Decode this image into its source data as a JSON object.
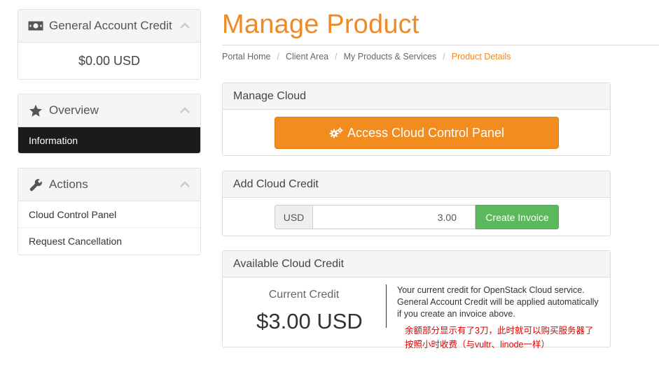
{
  "sidebar": {
    "account_credit": {
      "title": "General Account Credit",
      "amount": "$0.00 USD",
      "icon": "money-icon"
    },
    "overview": {
      "title": "Overview",
      "icon": "star-icon",
      "active_item": "Information"
    },
    "actions": {
      "title": "Actions",
      "icon": "wrench-icon",
      "items": [
        "Cloud Control Panel",
        "Request Cancellation"
      ]
    }
  },
  "main": {
    "title": "Manage Product",
    "breadcrumb": [
      "Portal Home",
      "Client Area",
      "My Products & Services",
      "Product Details"
    ],
    "manage_cloud": {
      "heading": "Manage Cloud",
      "button_label": "Access Cloud Control Panel",
      "button_icon": "cogs-icon"
    },
    "add_credit": {
      "heading": "Add Cloud Credit",
      "currency": "USD",
      "amount": "3.00",
      "button_label": "Create Invoice"
    },
    "available_credit": {
      "heading": "Available Cloud Credit",
      "label": "Current Credit",
      "value": "$3.00 USD",
      "description": "Your current credit for OpenStack Cloud service. General Account Credit will be applied automatically if you create an invoice above.",
      "annotation_line1": "余额部分显示有了3刀，此时就可以购买服务器了",
      "annotation_line2": "按照小时收费（与vultr、linode一样）"
    }
  },
  "colors": {
    "accent": "#f08a24",
    "button_orange": "#f28c1e",
    "button_green": "#5cb85c",
    "annotation": "#e00000",
    "active_bg": "#1b1b1b"
  }
}
